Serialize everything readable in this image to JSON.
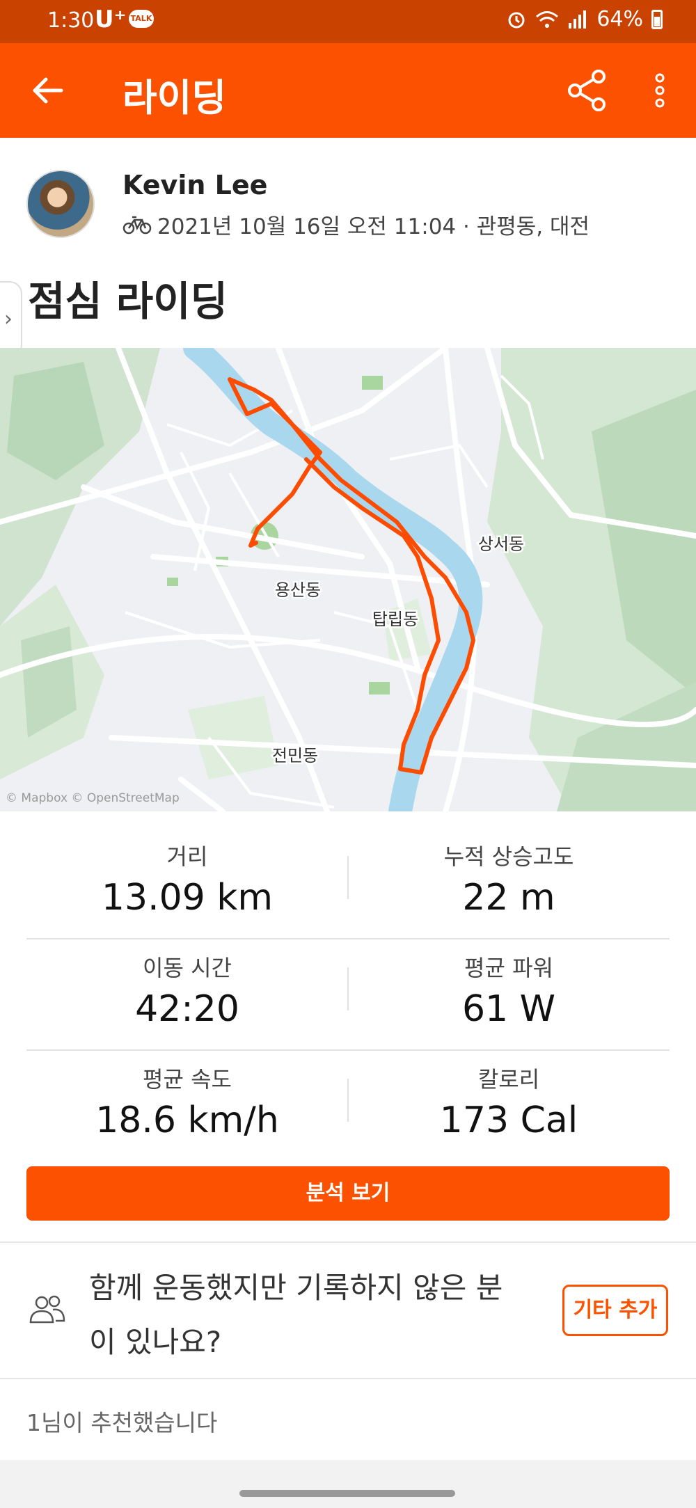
{
  "status_bar": {
    "time": "1:30",
    "carrier": "U⁺",
    "talk_badge": "TALK",
    "battery": "64%",
    "icons": [
      "alarm-icon",
      "wifi-icon",
      "signal-icon",
      "battery-icon"
    ]
  },
  "app_bar": {
    "title": "라이딩",
    "icons": [
      "back-arrow-icon",
      "share-icon",
      "more-vertical-icon"
    ],
    "color": "#fc5200"
  },
  "athlete": {
    "name": "Kevin Lee",
    "activity_meta": "2021년 10월 16일 오전 11:04 · 관평동, 대전",
    "sport_icon": "bicycle-icon"
  },
  "activity_title": "점심 라이딩",
  "map": {
    "labels": [
      "상서동",
      "용산동",
      "탑립동",
      "전민동"
    ],
    "attribution": "© Mapbox © OpenStreetMap",
    "route_color": "#fc4c02",
    "river_color": "#a9d8ee"
  },
  "stats": [
    {
      "label": "거리",
      "value": "13.09 km"
    },
    {
      "label": "누적 상승고도",
      "value": "22 m"
    },
    {
      "label": "이동 시간",
      "value": "42:20"
    },
    {
      "label": "평균 파워",
      "value": "61 W"
    },
    {
      "label": "평균 속도",
      "value": "18.6 km/h"
    },
    {
      "label": "칼로리",
      "value": "173 Cal"
    }
  ],
  "analyze_button": "분석 보기",
  "together": {
    "text": "함께 운동했지만 기록하지 않은 분이 있나요?",
    "button": "기타 추가",
    "icon": "group-icon"
  },
  "kudos_text": "1님이 추천했습니다"
}
